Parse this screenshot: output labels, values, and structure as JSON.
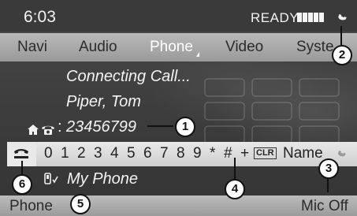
{
  "status": {
    "time": "6:03",
    "ready": "READY",
    "signal_bars": 5
  },
  "menu": {
    "items": [
      "Navi",
      "Audio",
      "Phone",
      "Video",
      "Syste"
    ],
    "active": "Phone"
  },
  "call": {
    "status_text": "Connecting Call...",
    "contact_name": "Piper, Tom",
    "number_prefix": ":",
    "number": "23456799"
  },
  "dialpad": {
    "keys": [
      "0",
      "1",
      "2",
      "3",
      "4",
      "5",
      "6",
      "7",
      "8",
      "9",
      "*",
      "#",
      "+"
    ],
    "clear_label": "CLR",
    "name_label": "Name"
  },
  "device": {
    "name": "My Phone"
  },
  "bottom": {
    "left_label": "Phone",
    "right_label": "Mic Off"
  },
  "callouts": [
    "1",
    "2",
    "3",
    "4",
    "5",
    "6"
  ],
  "icons": [
    "handset-icon",
    "home-icon",
    "telephone-icon",
    "hang-up-icon",
    "mobile-phone-icon",
    "signal-bars-icon"
  ]
}
